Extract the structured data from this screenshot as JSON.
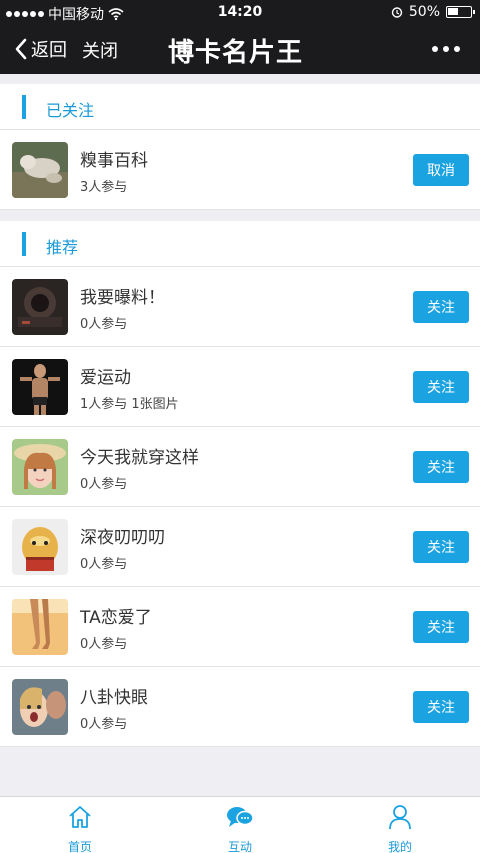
{
  "status_bar": {
    "carrier": "中国移动",
    "time": "14:20",
    "battery": "50%",
    "battery_level": 0.5
  },
  "nav": {
    "back": "返回",
    "close": "关闭",
    "title": "博卡名片王"
  },
  "followed": {
    "header": "已关注",
    "items": [
      {
        "name": "糗事百科",
        "meta": "3人参与",
        "button": "取消",
        "image": "dog-photo"
      }
    ]
  },
  "recommended": {
    "header": "推荐",
    "items": [
      {
        "name": "我要曝料！",
        "meta": "0人参与",
        "button": "关注",
        "image": "camera-photo"
      },
      {
        "name": "爱运动",
        "meta": "1人参与 1张图片",
        "button": "关注",
        "image": "fitness-photo"
      },
      {
        "name": "今天我就穿这样",
        "meta": "0人参与",
        "button": "关注",
        "image": "girl-hat-photo"
      },
      {
        "name": "深夜叨叨叨",
        "meta": "0人参与",
        "button": "关注",
        "image": "cartoon-photo"
      },
      {
        "name": "TA恋爱了",
        "meta": "0人参与",
        "button": "关注",
        "image": "beach-legs-photo"
      },
      {
        "name": "八卦快眼",
        "meta": "0人参与",
        "button": "关注",
        "image": "gossip-photo"
      }
    ]
  },
  "tabbar": [
    {
      "label": "首页",
      "icon": "home-icon"
    },
    {
      "label": "互动",
      "icon": "chat-bubbles-icon"
    },
    {
      "label": "我的",
      "icon": "user-icon"
    }
  ],
  "colors": {
    "accent": "#1aa3e0",
    "header_bg": "#1b1b1d",
    "page_bg": "#eeeef3"
  }
}
